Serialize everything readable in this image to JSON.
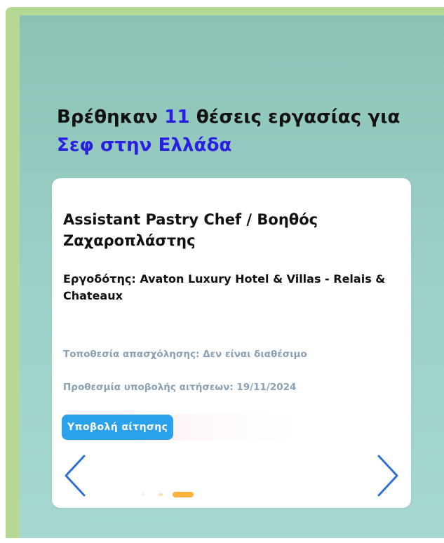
{
  "headline": {
    "prefix": "Βρέθηκαν ",
    "count": "11",
    "middle": " θέσεις εργασίας για ",
    "query": "Σεφ στην Ελλάδα"
  },
  "job_card": {
    "title": "Assistant Pastry Chef / Βοηθός Ζαχαροπλάστης",
    "employer": "Εργοδότης: Avaton Luxury Hotel & Villas - Relais & Chateaux",
    "location": "Τοποθεσία απασχόλησης: Δεν είναι διαθέσιμο",
    "deadline": "Προθεσμία υποβολής αιτήσεων: 19/11/2024",
    "apply_label": "Υποβολή αίτησης"
  },
  "carousel": {
    "prev_icon": "chevron-left-icon",
    "next_icon": "chevron-right-icon",
    "slide_count": 3,
    "active_slide": 3
  },
  "colors": {
    "frame_green": "#b5d895",
    "panel_teal": "#9bcfc6",
    "highlight_blue": "#2a1fe0",
    "button_blue": "#2aa1ec",
    "nav_blue": "#2f6fdb",
    "meta_gray": "#8aa0b4",
    "dot_active": "#fbb23f"
  }
}
